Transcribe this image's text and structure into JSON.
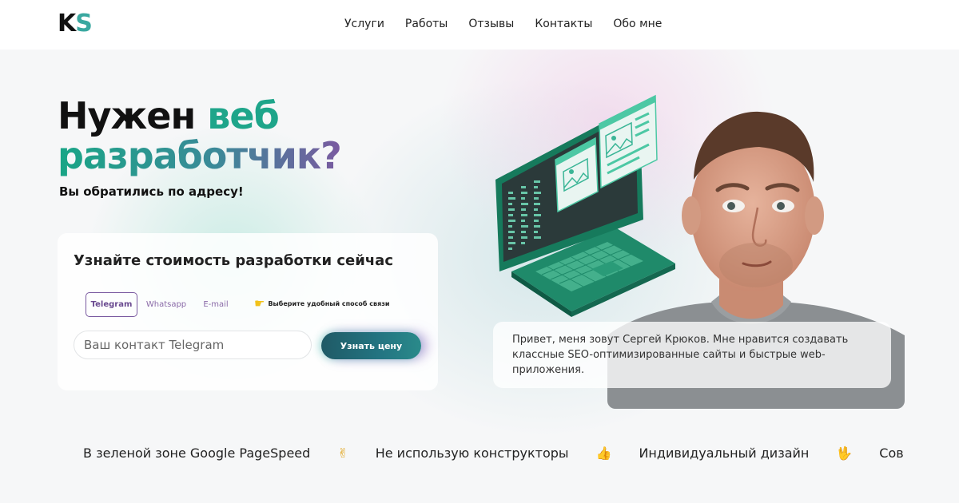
{
  "header": {
    "logo_k": "K",
    "logo_s": "S",
    "nav": [
      "Услуги",
      "Работы",
      "Отзывы",
      "Контакты",
      "Обо мне"
    ]
  },
  "hero": {
    "title_line1_plain": "Нужен",
    "title_line1_accent": "веб",
    "title_line2": "разработчик?",
    "subtitle": "Вы обратились по адресу!"
  },
  "form": {
    "title": "Узнайте стоимость разработки сейчас",
    "tabs": [
      "Telegram",
      "Whatsapp",
      "E-mail"
    ],
    "active_tab": "Telegram",
    "hint": "Выберите удобный способ связи",
    "input_placeholder": "Ваш контакт Telegram",
    "button_label": "Узнать цену"
  },
  "about": {
    "text": "Привет, меня зовут Сергей Крюков. Мне нравится создавать классные SEO-оптимизированные сайты и быстрые web-приложения."
  },
  "ticker": {
    "items": [
      "В зеленой зоне Google PageSpeed",
      "Не использую конструкторы",
      "Индивидуальный дизайн",
      "Совр"
    ],
    "icons": [
      "victory-hand-icon",
      "thumbs-up-icon",
      "vulcan-salute-icon"
    ]
  },
  "colors": {
    "accent_green": "#1ea58a",
    "accent_purple": "#7a5aa0",
    "button_teal": "#237582",
    "laptop_green": "#1f8a6a"
  }
}
